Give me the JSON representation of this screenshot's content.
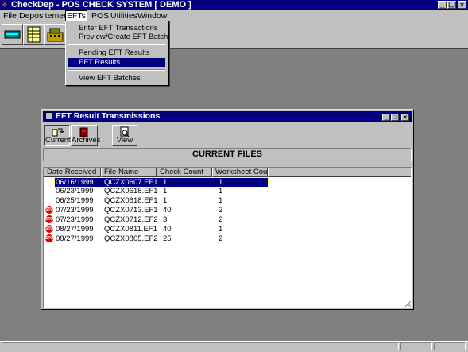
{
  "app": {
    "title": "CheckDep - POS CHECK SYSTEM [ DEMO ]"
  },
  "menubar": {
    "items": [
      "File",
      "Depositement",
      "EFTs",
      "POS",
      "Utilities",
      "Window"
    ]
  },
  "efts_menu": {
    "items": [
      {
        "label": "Enter EFT Transactions",
        "selected": false
      },
      {
        "label": "Preview/Create EFT Batch",
        "selected": false
      },
      {
        "label": "Pending EFT Results",
        "selected": false
      },
      {
        "label": "EFT Results",
        "selected": true
      },
      {
        "label": "View EFT Batches",
        "selected": false
      }
    ]
  },
  "child_window": {
    "title": "EFT Result Transmissions",
    "toolbar": {
      "current_label": "Current",
      "archives_label": "Archives",
      "view_label": "View"
    },
    "section_title": "CURRENT FILES",
    "columns": [
      "Date Received",
      "File Name",
      "Check Count",
      "Worksheet Count"
    ],
    "rows": [
      {
        "stop": false,
        "selected": true,
        "date": "06/16/1999",
        "file": "QCZX0607.EF1",
        "checks": "1",
        "worksheets": "1"
      },
      {
        "stop": false,
        "selected": false,
        "date": "06/23/1999",
        "file": "QCZX0618.EF1",
        "checks": "1",
        "worksheets": "1"
      },
      {
        "stop": false,
        "selected": false,
        "date": "06/25/1999",
        "file": "QCZX0618.EF1",
        "checks": "1",
        "worksheets": "1"
      },
      {
        "stop": true,
        "selected": false,
        "date": "07/23/1999",
        "file": "QCZX0713.EF1",
        "checks": "40",
        "worksheets": "2"
      },
      {
        "stop": true,
        "selected": false,
        "date": "07/23/1999",
        "file": "QCZX0712.EF2",
        "checks": "3",
        "worksheets": "2"
      },
      {
        "stop": true,
        "selected": false,
        "date": "08/27/1999",
        "file": "QCZX0811.EF1",
        "checks": "40",
        "worksheets": "1"
      },
      {
        "stop": true,
        "selected": false,
        "date": "08/27/1999",
        "file": "QCZX0805.EF2",
        "checks": "25",
        "worksheets": "2"
      }
    ]
  },
  "icons": {
    "stop_icon_text": "STOP"
  },
  "colors": {
    "titlebar": "#000080",
    "face": "#c0c0c0",
    "desktop": "#808080",
    "selection": "#000080",
    "stop": "#e00000"
  }
}
